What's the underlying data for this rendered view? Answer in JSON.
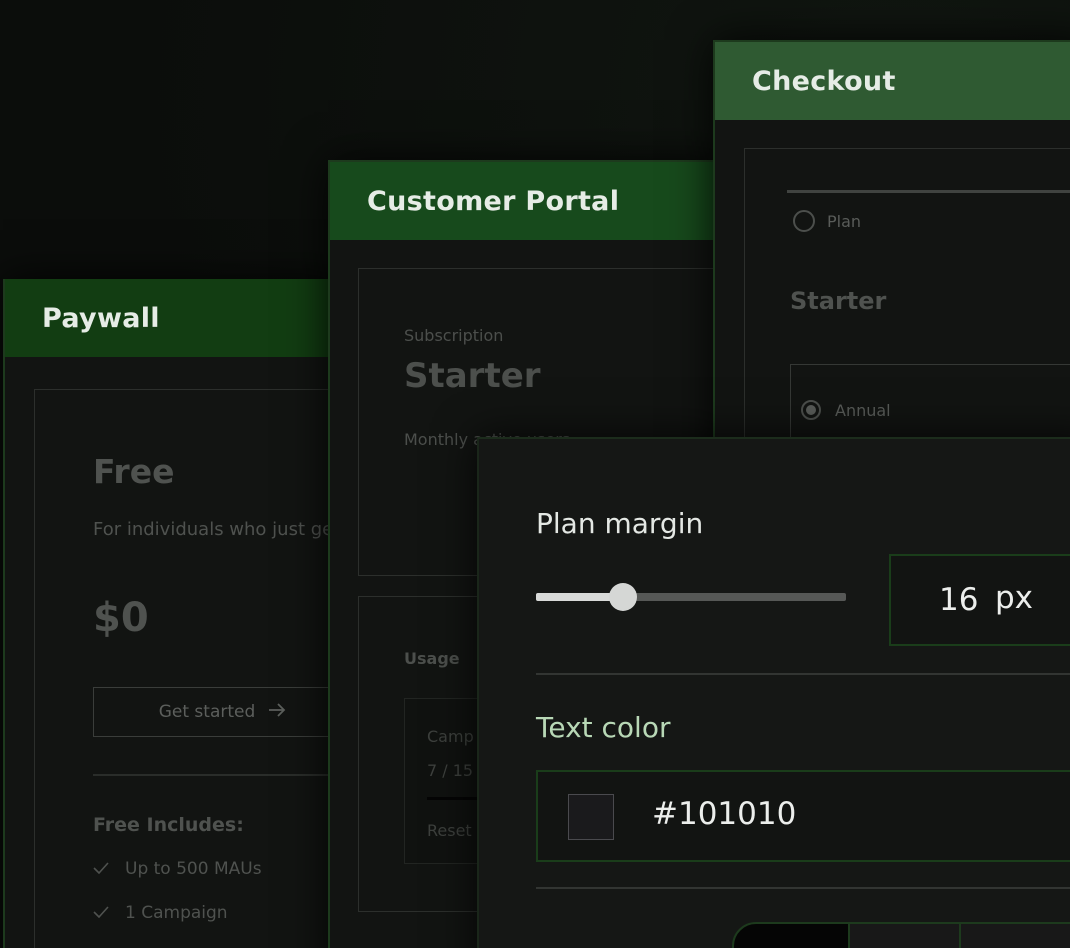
{
  "paywall": {
    "header": "Paywall",
    "plan_name": "Free",
    "description": "For individuals who just get started.",
    "price": "$0",
    "cta_label": "Get started",
    "includes_title": "Free Includes:",
    "features": [
      "Up to 500 MAUs",
      "1 Campaign"
    ]
  },
  "portal": {
    "header": "Customer Portal",
    "subscription_label": "Subscription",
    "plan_name": "Starter",
    "mau_label": "Monthly active users",
    "usage_label": "Usage",
    "campaign_label": "Camp",
    "campaign_count": "7 / 15",
    "reset_label": "Reset"
  },
  "checkout": {
    "header": "Checkout",
    "plan_radio_label": "Plan",
    "plan_name": "Starter",
    "billing_option": "Annual"
  },
  "settings": {
    "plan_margin_label": "Plan margin",
    "plan_margin_value": "16",
    "plan_margin_unit": "px",
    "plan_margin_slider_fraction": 0.28,
    "text_color_label": "Text color",
    "text_color_value": "#101010"
  },
  "colors": {
    "paywall_header": "#123d12",
    "portal_header": "#174a1c",
    "checkout_header": "#2f5a32",
    "field_border": "#1a3d1a"
  }
}
